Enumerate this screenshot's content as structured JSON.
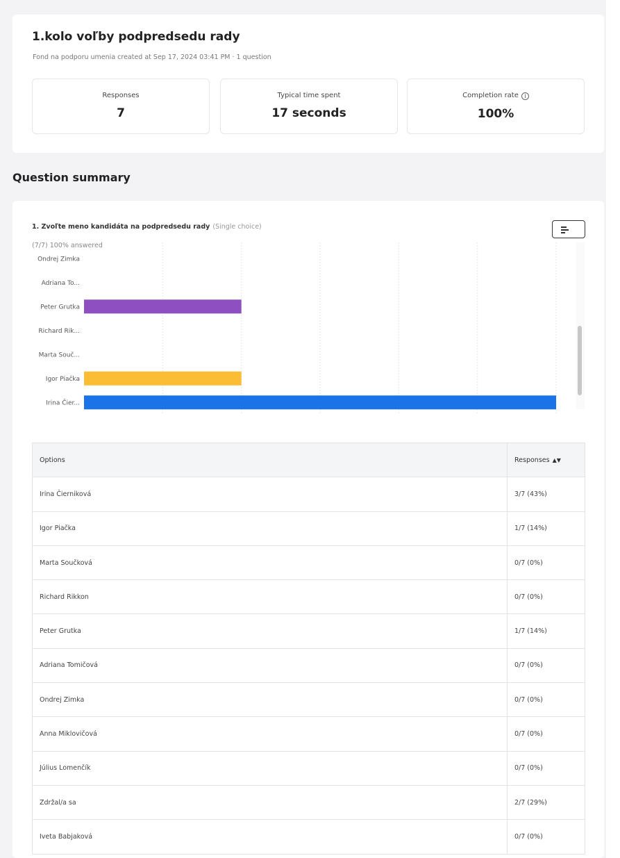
{
  "survey": {
    "title": "1.kolo voľby podpredsedu rady",
    "meta": "Fond na podporu umenia created at Sep 17, 2024 03:41 PM  ·  1 question"
  },
  "stats": [
    {
      "label": "Responses",
      "value": "7"
    },
    {
      "label": "Typical time spent",
      "value": "17 seconds"
    },
    {
      "label": "Completion rate",
      "value": "100%"
    }
  ],
  "section_title": "Question summary",
  "question": {
    "title": "1. Zvoľte meno kandidáta na podpredsedu rady",
    "type": "(Single choice)",
    "answered": "(7/7) 100% answered"
  },
  "chart_data": {
    "type": "bar",
    "orientation": "horizontal",
    "categories": [
      "Ondrej Zimka",
      "Adriana To...",
      "Peter Grutka",
      "Richard Rik...",
      "Marta Souč...",
      "Igor Piačka",
      "Irina Čier..."
    ],
    "values": [
      0,
      0,
      1,
      0,
      0,
      1,
      3
    ],
    "colors": [
      "#9b59b6",
      "#9b59b6",
      "#8e4fc1",
      "#9b59b6",
      "#9b59b6",
      "#fbbd34",
      "#1b73e8"
    ],
    "xlim": [
      0,
      3
    ],
    "xticks": [
      "0",
      "0.5",
      "1",
      "1.5",
      "2",
      "2.5",
      "3"
    ],
    "grid": true
  },
  "table": {
    "headers": {
      "options": "Options",
      "responses": "Responses"
    },
    "rows": [
      {
        "option": "Irina Čierniková",
        "responses": "3/7 (43%)"
      },
      {
        "option": "Igor Piačka",
        "responses": "1/7 (14%)"
      },
      {
        "option": "Marta Součková",
        "responses": "0/7 (0%)"
      },
      {
        "option": "Richard Rikkon",
        "responses": "0/7 (0%)"
      },
      {
        "option": "Peter Grutka",
        "responses": "1/7 (14%)"
      },
      {
        "option": "Adriana Tomičová",
        "responses": "0/7 (0%)"
      },
      {
        "option": "Ondrej Zimka",
        "responses": "0/7 (0%)"
      },
      {
        "option": "Anna Miklovičová",
        "responses": "0/7 (0%)"
      },
      {
        "option": "Július Lomenčík",
        "responses": "0/7 (0%)"
      },
      {
        "option": "Zdržal/a sa",
        "responses": "2/7 (29%)"
      },
      {
        "option": "Iveta Babjaková",
        "responses": "0/7 (0%)"
      }
    ]
  }
}
